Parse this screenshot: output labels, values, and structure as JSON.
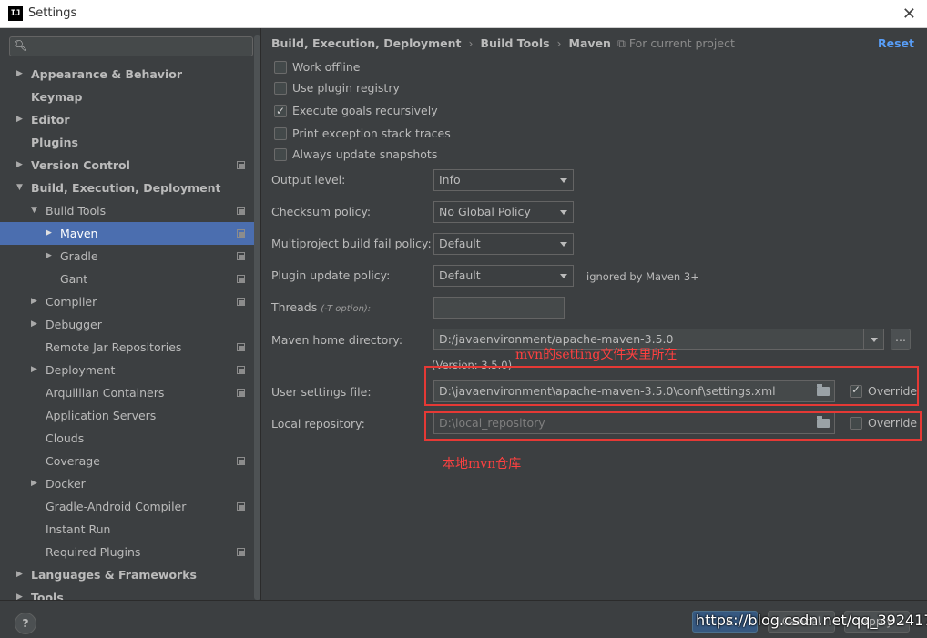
{
  "window": {
    "title": "Settings",
    "app_icon": "IJ"
  },
  "sidebar": {
    "search_placeholder": "",
    "items": [
      {
        "label": "Appearance & Behavior",
        "level": 0,
        "arrow": "right",
        "bold": true,
        "copy": false,
        "selected": false
      },
      {
        "label": "Keymap",
        "level": 0,
        "arrow": "none",
        "bold": true,
        "copy": false,
        "selected": false
      },
      {
        "label": "Editor",
        "level": 0,
        "arrow": "right",
        "bold": true,
        "copy": false,
        "selected": false
      },
      {
        "label": "Plugins",
        "level": 0,
        "arrow": "none",
        "bold": true,
        "copy": false,
        "selected": false
      },
      {
        "label": "Version Control",
        "level": 0,
        "arrow": "right",
        "bold": true,
        "copy": true,
        "selected": false
      },
      {
        "label": "Build, Execution, Deployment",
        "level": 0,
        "arrow": "down",
        "bold": true,
        "copy": false,
        "selected": false
      },
      {
        "label": "Build Tools",
        "level": 1,
        "arrow": "down",
        "bold": false,
        "copy": true,
        "selected": false
      },
      {
        "label": "Maven",
        "level": 2,
        "arrow": "right",
        "bold": false,
        "copy": true,
        "selected": true
      },
      {
        "label": "Gradle",
        "level": 2,
        "arrow": "right",
        "bold": false,
        "copy": true,
        "selected": false
      },
      {
        "label": "Gant",
        "level": 2,
        "arrow": "none",
        "bold": false,
        "copy": true,
        "selected": false
      },
      {
        "label": "Compiler",
        "level": 1,
        "arrow": "right",
        "bold": false,
        "copy": true,
        "selected": false
      },
      {
        "label": "Debugger",
        "level": 1,
        "arrow": "right",
        "bold": false,
        "copy": false,
        "selected": false
      },
      {
        "label": "Remote Jar Repositories",
        "level": 1,
        "arrow": "none",
        "bold": false,
        "copy": true,
        "selected": false
      },
      {
        "label": "Deployment",
        "level": 1,
        "arrow": "right",
        "bold": false,
        "copy": true,
        "selected": false
      },
      {
        "label": "Arquillian Containers",
        "level": 1,
        "arrow": "none",
        "bold": false,
        "copy": true,
        "selected": false
      },
      {
        "label": "Application Servers",
        "level": 1,
        "arrow": "none",
        "bold": false,
        "copy": false,
        "selected": false
      },
      {
        "label": "Clouds",
        "level": 1,
        "arrow": "none",
        "bold": false,
        "copy": false,
        "selected": false
      },
      {
        "label": "Coverage",
        "level": 1,
        "arrow": "none",
        "bold": false,
        "copy": true,
        "selected": false
      },
      {
        "label": "Docker",
        "level": 1,
        "arrow": "right",
        "bold": false,
        "copy": false,
        "selected": false
      },
      {
        "label": "Gradle-Android Compiler",
        "level": 1,
        "arrow": "none",
        "bold": false,
        "copy": true,
        "selected": false
      },
      {
        "label": "Instant Run",
        "level": 1,
        "arrow": "none",
        "bold": false,
        "copy": false,
        "selected": false
      },
      {
        "label": "Required Plugins",
        "level": 1,
        "arrow": "none",
        "bold": false,
        "copy": true,
        "selected": false
      },
      {
        "label": "Languages & Frameworks",
        "level": 0,
        "arrow": "right",
        "bold": true,
        "copy": false,
        "selected": false
      },
      {
        "label": "Tools",
        "level": 0,
        "arrow": "right",
        "bold": true,
        "copy": false,
        "selected": false
      }
    ]
  },
  "header": {
    "breadcrumb": [
      "Build, Execution, Deployment",
      "Build Tools",
      "Maven"
    ],
    "separator": "›",
    "for_project": "For current project",
    "reset": "Reset"
  },
  "options": {
    "work_offline": "Work offline",
    "use_plugin_registry": "Use plugin registry",
    "execute_goals": "Execute goals recursively",
    "print_exception": "Print exception stack traces",
    "always_update": "Always update snapshots"
  },
  "fields": {
    "output_level": {
      "label": "Output level:",
      "value": "Info"
    },
    "checksum_policy": {
      "label": "Checksum policy:",
      "value": "No Global Policy"
    },
    "multiproject": {
      "label": "Multiproject build fail policy:",
      "value": "Default"
    },
    "plugin_update": {
      "label": "Plugin update policy:",
      "value": "Default",
      "note": "ignored by Maven 3+"
    },
    "threads": {
      "label": "Threads",
      "hint": "(-T option):",
      "value": ""
    },
    "maven_home": {
      "label": "Maven home directory:",
      "value": "D:/javaenvironment/apache-maven-3.5.0",
      "version": "(Version: 3.5.0)",
      "button": "..."
    },
    "user_settings": {
      "label": "User settings file:",
      "value": "D:\\javaenvironment\\apache-maven-3.5.0\\conf\\settings.xml",
      "override": "Override"
    },
    "local_repo": {
      "label": "Local repository:",
      "value": "D:\\local_repository",
      "override": "Override"
    }
  },
  "annotations": {
    "settings_note": "mvn的setting文件夹里所在",
    "repo_note": "本地mvn仓库"
  },
  "footer": {
    "help": "?",
    "ok": "OK",
    "cancel": "Cancel",
    "apply": "Apply",
    "watermark": "https://blog.csdn.net/qq_39241758"
  },
  "colors": {
    "background": "#3c3f41",
    "selection": "#4b6eaf",
    "link": "#589df6",
    "annotation": "#e53935"
  }
}
